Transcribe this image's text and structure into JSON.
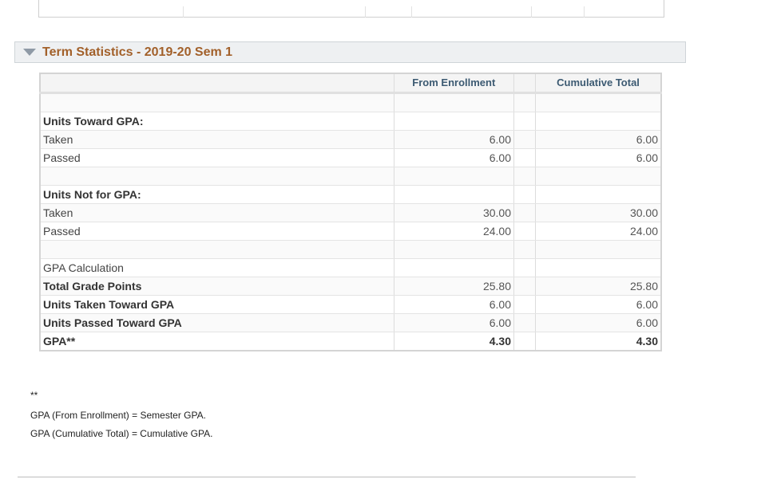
{
  "section": {
    "title": "Term Statistics - 2019-20 Sem 1"
  },
  "table": {
    "headers": [
      "",
      "From Enrollment",
      "",
      "Cumulative Total"
    ],
    "rows": [
      {
        "label": "",
        "enrollment": "",
        "cumulative": "",
        "bold": false
      },
      {
        "label": "Units Toward GPA:",
        "enrollment": "",
        "cumulative": "",
        "bold": true
      },
      {
        "label": "Taken",
        "enrollment": "6.00",
        "cumulative": "6.00",
        "bold": false
      },
      {
        "label": "Passed",
        "enrollment": "6.00",
        "cumulative": "6.00",
        "bold": false
      },
      {
        "label": "",
        "enrollment": "",
        "cumulative": "",
        "bold": false
      },
      {
        "label": "Units Not for GPA:",
        "enrollment": "",
        "cumulative": "",
        "bold": true
      },
      {
        "label": "Taken",
        "enrollment": "30.00",
        "cumulative": "30.00",
        "bold": false
      },
      {
        "label": "Passed",
        "enrollment": "24.00",
        "cumulative": "24.00",
        "bold": false
      },
      {
        "label": "",
        "enrollment": "",
        "cumulative": "",
        "bold": false
      },
      {
        "label": "GPA Calculation",
        "enrollment": "",
        "cumulative": "",
        "bold": false
      },
      {
        "label": "Total Grade Points",
        "enrollment": "25.80",
        "cumulative": "25.80",
        "bold": true
      },
      {
        "label": "Units Taken Toward GPA",
        "enrollment": "6.00",
        "cumulative": "6.00",
        "bold": true
      },
      {
        "label": "Units Passed Toward GPA",
        "enrollment": "6.00",
        "cumulative": "6.00",
        "bold": true
      },
      {
        "label": "GPA**",
        "enrollment": "4.30",
        "cumulative": "4.30",
        "bold": true,
        "bold_values": true
      }
    ]
  },
  "footnote": {
    "marker": "**",
    "line1": "GPA (From Enrollment) = Semester GPA.",
    "line2": "GPA (Cumulative Total) = Cumulative GPA."
  }
}
